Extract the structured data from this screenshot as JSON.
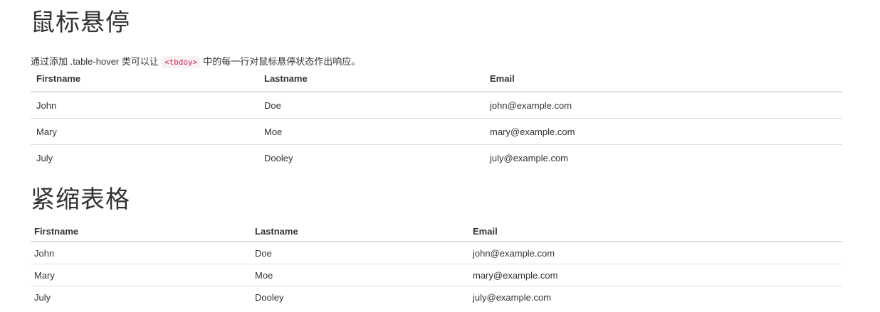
{
  "hover_section": {
    "title": "鼠标悬停",
    "desc_before": "通过添加 .table-hover 类可以让",
    "desc_code": "<tbdoy>",
    "desc_after": "中的每一行对鼠标悬停状态作出响应。",
    "headers": [
      "Firstname",
      "Lastname",
      "Email"
    ],
    "rows": [
      [
        "John",
        "Doe",
        "john@example.com"
      ],
      [
        "Mary",
        "Moe",
        "mary@example.com"
      ],
      [
        "July",
        "Dooley",
        "july@example.com"
      ]
    ]
  },
  "condensed_section": {
    "title": "紧缩表格",
    "headers": [
      "Firstname",
      "Lastname",
      "Email"
    ],
    "rows": [
      [
        "John",
        "Doe",
        "john@example.com"
      ],
      [
        "Mary",
        "Moe",
        "mary@example.com"
      ],
      [
        "July",
        "Dooley",
        "july@example.com"
      ]
    ]
  }
}
